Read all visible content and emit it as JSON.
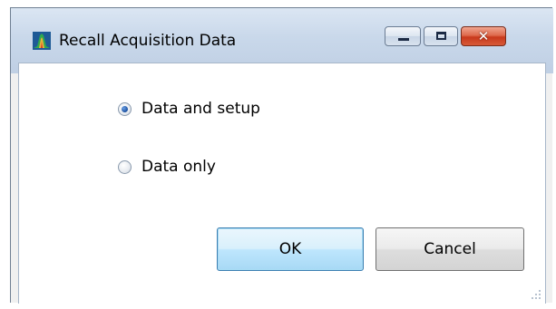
{
  "window": {
    "title": "Recall Acquisition Data",
    "caption_buttons": {
      "minimize": "minimize-icon",
      "maximize": "maximize-icon",
      "close": "close-icon",
      "close_glyph": "✕"
    }
  },
  "options": [
    {
      "label": "Data and setup",
      "checked": true
    },
    {
      "label": "Data only",
      "checked": false
    }
  ],
  "buttons": {
    "ok": "OK",
    "cancel": "Cancel"
  },
  "colors": {
    "default_button_border": "#3c7fb1",
    "close_button": "#c8391c",
    "radio_selected": "#1b4f9e"
  }
}
